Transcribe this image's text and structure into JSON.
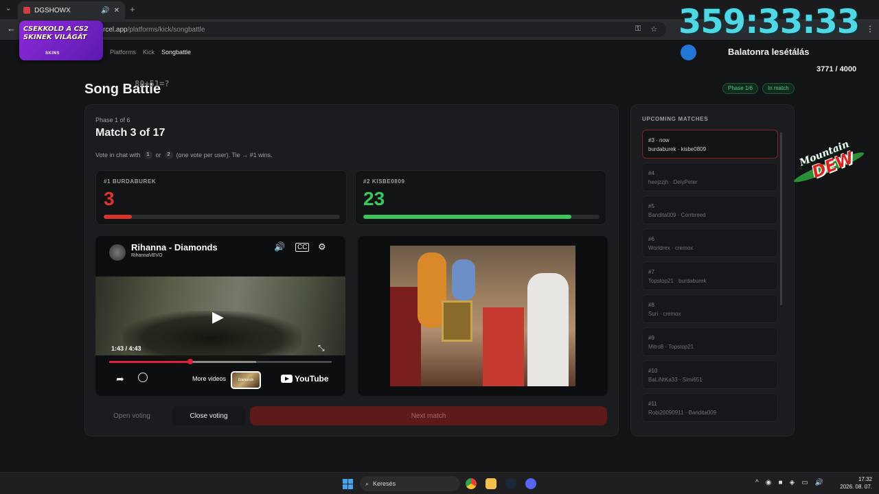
{
  "browser": {
    "tab_title": "DGSHOWX",
    "url_host": "rcel.app",
    "url_path": "/platforms/kick/songbattle"
  },
  "overlay": {
    "sponsor_line1": "CSEKKOLD A CS2",
    "sponsor_line2": "SKINEK VILÁGÁT",
    "sponsor_brand": "SKINS",
    "timer": "359:33:33",
    "goal_label": "Balatonra lesétálás",
    "goal_count": "3771 / 4000",
    "brand_logo_line1": "Mountain",
    "brand_logo_line2": "DEW"
  },
  "breadcrumb": [
    "Platforms",
    "Kick",
    "Songbattle"
  ],
  "page": {
    "title": "Song Battle",
    "math_overlay": "80+51=?",
    "pill_phase": "Phase 1/6",
    "pill_status": "In match"
  },
  "match": {
    "phase": "Phase 1 of 6",
    "title": "Match 3 of 17",
    "instr_pre": "Vote in chat with",
    "key1": "1",
    "instr_or": "or",
    "key2": "2",
    "instr_post": "(one vote per user). Tie → #1 wins.",
    "contestants": [
      {
        "label": "#1 BURDABUREK",
        "score": "3",
        "ratio": 0.12,
        "color": "#d9342b"
      },
      {
        "label": "#2 KISBE0809",
        "score": "23",
        "ratio": 0.88,
        "color": "#3cc55c"
      }
    ]
  },
  "video1": {
    "title": "Rihanna - Diamonds",
    "channel": "RihannaVEVO",
    "time": "1:43 / 4:43",
    "played_fraction": 0.364,
    "buffered_fraction": 0.66,
    "more_videos": "More videos",
    "thumb_text": "Diamonds",
    "logo": "YouTube"
  },
  "buttons": {
    "open_voting": "Open voting",
    "close_voting": "Close voting",
    "next_match": "Next match"
  },
  "upcoming": {
    "title": "UPCOMING MATCHES",
    "items": [
      {
        "num": "#3 · now",
        "teams": "burdaburek · kisbe0809"
      },
      {
        "num": "#4",
        "teams": "heejzzjh · DelyPeter"
      },
      {
        "num": "#5",
        "teams": "Bandita009 · Corrbreed"
      },
      {
        "num": "#6",
        "teams": "Worldrex · cremox"
      },
      {
        "num": "#7",
        "teams": "Topstop21 · burdaburek"
      },
      {
        "num": "#8",
        "teams": "Suri · cremox"
      },
      {
        "num": "#9",
        "teams": "Mitro8 · Topstop21"
      },
      {
        "num": "#10",
        "teams": "BaLiNtKa33 · Simi651"
      },
      {
        "num": "#11",
        "teams": "Robi20090911 · Bandita009"
      }
    ]
  },
  "taskbar": {
    "search_label": "Keresés",
    "time": "17:32",
    "date": "2026. 08. 07."
  }
}
